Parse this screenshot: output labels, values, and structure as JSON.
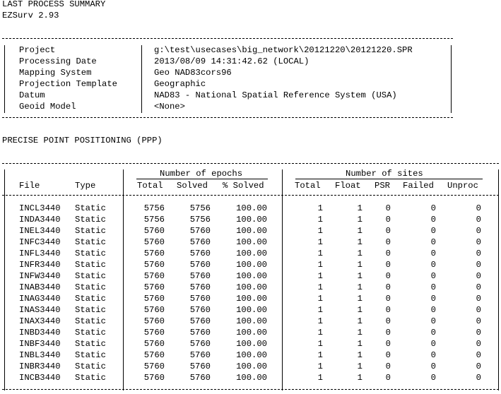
{
  "header": {
    "title": "LAST PROCESS SUMMARY",
    "app_version": "EZSurv 2.93"
  },
  "summary": [
    {
      "label": "Project",
      "value": "g:\\test\\usecases\\big_network\\20121220\\20121220.SPR"
    },
    {
      "label": "Processing Date",
      "value": "2013/08/09 14:31:42.62 (LOCAL)"
    },
    {
      "label": "Mapping System",
      "value": "Geo NAD83cors96"
    },
    {
      "label": "Projection Template",
      "value": "Geographic"
    },
    {
      "label": "Datum",
      "value": "NAD83 - National Spatial Reference System (USA)"
    },
    {
      "label": "Geoid Model",
      "value": "<None>"
    }
  ],
  "ppp": {
    "section_title": "PRECISE POINT POSITIONING (PPP)",
    "group_epochs": "Number of epochs",
    "group_sites": "Number of sites",
    "columns": {
      "file": "File",
      "type": "Type",
      "ep_total": "Total",
      "ep_solved": "Solved",
      "ep_pct": "% Solved",
      "st_total": "Total",
      "st_float": "Float",
      "st_psr": "PSR",
      "st_failed": "Failed",
      "st_unproc": "Unproc"
    },
    "rows": [
      {
        "file": "INCL3440",
        "type": "Static",
        "ep_total": "5756",
        "ep_solved": "5756",
        "ep_pct": "100.00",
        "st_total": "1",
        "st_float": "1",
        "st_psr": "0",
        "st_failed": "0",
        "st_unproc": "0"
      },
      {
        "file": "INDA3440",
        "type": "Static",
        "ep_total": "5756",
        "ep_solved": "5756",
        "ep_pct": "100.00",
        "st_total": "1",
        "st_float": "1",
        "st_psr": "0",
        "st_failed": "0",
        "st_unproc": "0"
      },
      {
        "file": "INEL3440",
        "type": "Static",
        "ep_total": "5760",
        "ep_solved": "5760",
        "ep_pct": "100.00",
        "st_total": "1",
        "st_float": "1",
        "st_psr": "0",
        "st_failed": "0",
        "st_unproc": "0"
      },
      {
        "file": "INFC3440",
        "type": "Static",
        "ep_total": "5760",
        "ep_solved": "5760",
        "ep_pct": "100.00",
        "st_total": "1",
        "st_float": "1",
        "st_psr": "0",
        "st_failed": "0",
        "st_unproc": "0"
      },
      {
        "file": "INFL3440",
        "type": "Static",
        "ep_total": "5760",
        "ep_solved": "5760",
        "ep_pct": "100.00",
        "st_total": "1",
        "st_float": "1",
        "st_psr": "0",
        "st_failed": "0",
        "st_unproc": "0"
      },
      {
        "file": "INFR3440",
        "type": "Static",
        "ep_total": "5760",
        "ep_solved": "5760",
        "ep_pct": "100.00",
        "st_total": "1",
        "st_float": "1",
        "st_psr": "0",
        "st_failed": "0",
        "st_unproc": "0"
      },
      {
        "file": "INFW3440",
        "type": "Static",
        "ep_total": "5760",
        "ep_solved": "5760",
        "ep_pct": "100.00",
        "st_total": "1",
        "st_float": "1",
        "st_psr": "0",
        "st_failed": "0",
        "st_unproc": "0"
      },
      {
        "file": "INAB3440",
        "type": "Static",
        "ep_total": "5760",
        "ep_solved": "5760",
        "ep_pct": "100.00",
        "st_total": "1",
        "st_float": "1",
        "st_psr": "0",
        "st_failed": "0",
        "st_unproc": "0"
      },
      {
        "file": "INAG3440",
        "type": "Static",
        "ep_total": "5760",
        "ep_solved": "5760",
        "ep_pct": "100.00",
        "st_total": "1",
        "st_float": "1",
        "st_psr": "0",
        "st_failed": "0",
        "st_unproc": "0"
      },
      {
        "file": "INAS3440",
        "type": "Static",
        "ep_total": "5760",
        "ep_solved": "5760",
        "ep_pct": "100.00",
        "st_total": "1",
        "st_float": "1",
        "st_psr": "0",
        "st_failed": "0",
        "st_unproc": "0"
      },
      {
        "file": "INAX3440",
        "type": "Static",
        "ep_total": "5760",
        "ep_solved": "5760",
        "ep_pct": "100.00",
        "st_total": "1",
        "st_float": "1",
        "st_psr": "0",
        "st_failed": "0",
        "st_unproc": "0"
      },
      {
        "file": "INBD3440",
        "type": "Static",
        "ep_total": "5760",
        "ep_solved": "5760",
        "ep_pct": "100.00",
        "st_total": "1",
        "st_float": "1",
        "st_psr": "0",
        "st_failed": "0",
        "st_unproc": "0"
      },
      {
        "file": "INBF3440",
        "type": "Static",
        "ep_total": "5760",
        "ep_solved": "5760",
        "ep_pct": "100.00",
        "st_total": "1",
        "st_float": "1",
        "st_psr": "0",
        "st_failed": "0",
        "st_unproc": "0"
      },
      {
        "file": "INBL3440",
        "type": "Static",
        "ep_total": "5760",
        "ep_solved": "5760",
        "ep_pct": "100.00",
        "st_total": "1",
        "st_float": "1",
        "st_psr": "0",
        "st_failed": "0",
        "st_unproc": "0"
      },
      {
        "file": "INBR3440",
        "type": "Static",
        "ep_total": "5760",
        "ep_solved": "5760",
        "ep_pct": "100.00",
        "st_total": "1",
        "st_float": "1",
        "st_psr": "0",
        "st_failed": "0",
        "st_unproc": "0"
      },
      {
        "file": "INCB3440",
        "type": "Static",
        "ep_total": "5760",
        "ep_solved": "5760",
        "ep_pct": "100.00",
        "st_total": "1",
        "st_float": "1",
        "st_psr": "0",
        "st_failed": "0",
        "st_unproc": "0"
      }
    ]
  }
}
